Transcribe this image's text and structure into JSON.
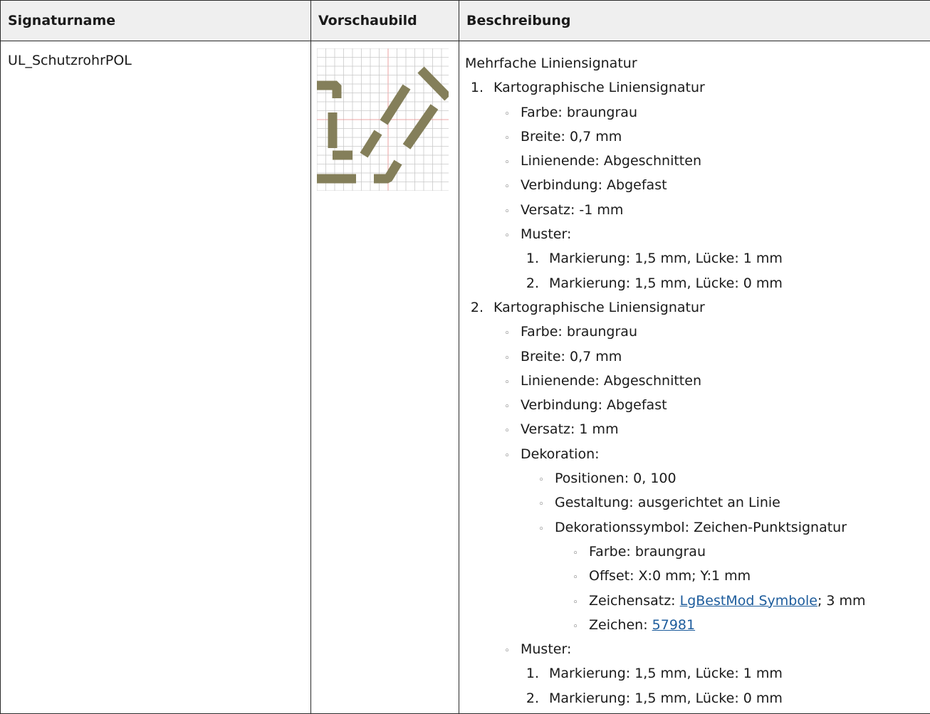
{
  "headers": {
    "name": "Signaturname",
    "preview": "Vorschaubild",
    "description": "Beschreibung"
  },
  "row": {
    "name": "UL_SchutzrohrPOL",
    "preview_color": "#847f5a",
    "description": {
      "intro": "Mehrfache Liniensignatur",
      "items": [
        {
          "num": "1.",
          "title": "Kartographische Liniensignatur",
          "props": {
            "farbe": "Farbe: braungrau",
            "breite": "Breite: 0,7 mm",
            "linienende": "Linienende: Abgeschnitten",
            "verbindung": "Verbindung: Abgefast",
            "versatz": "Versatz: -1 mm",
            "muster": "Muster:"
          },
          "muster": [
            {
              "num": "1.",
              "text": "Markierung: 1,5 mm, Lücke: 1 mm"
            },
            {
              "num": "2.",
              "text": "Markierung: 1,5 mm, Lücke: 0 mm"
            }
          ]
        },
        {
          "num": "2.",
          "title": "Kartographische Liniensignatur",
          "props": {
            "farbe": "Farbe: braungrau",
            "breite": "Breite: 0,7 mm",
            "linienende": "Linienende: Abgeschnitten",
            "verbindung": "Verbindung: Abgefast",
            "versatz": "Versatz: 1 mm",
            "dekoration": "Dekoration:",
            "muster": "Muster:"
          },
          "dekoration": {
            "positionen": "Positionen: 0, 100",
            "gestaltung": "Gestaltung: ausgerichtet an Linie",
            "symbol": "Dekorationssymbol: Zeichen-Punktsignatur",
            "symbol_props": {
              "farbe": "Farbe: braungrau",
              "offset": "Offset: X:0 mm; Y:1 mm",
              "zeichensatz_prefix": "Zeichensatz: ",
              "zeichensatz_link": "LgBestMod Symbole",
              "zeichensatz_suffix": "; 3 mm",
              "zeichen_prefix": "Zeichen: ",
              "zeichen_link": "57981"
            }
          },
          "muster": [
            {
              "num": "1.",
              "text": "Markierung: 1,5 mm, Lücke: 1 mm"
            },
            {
              "num": "2.",
              "text": "Markierung: 1,5 mm, Lücke: 0 mm"
            }
          ]
        }
      ]
    }
  }
}
